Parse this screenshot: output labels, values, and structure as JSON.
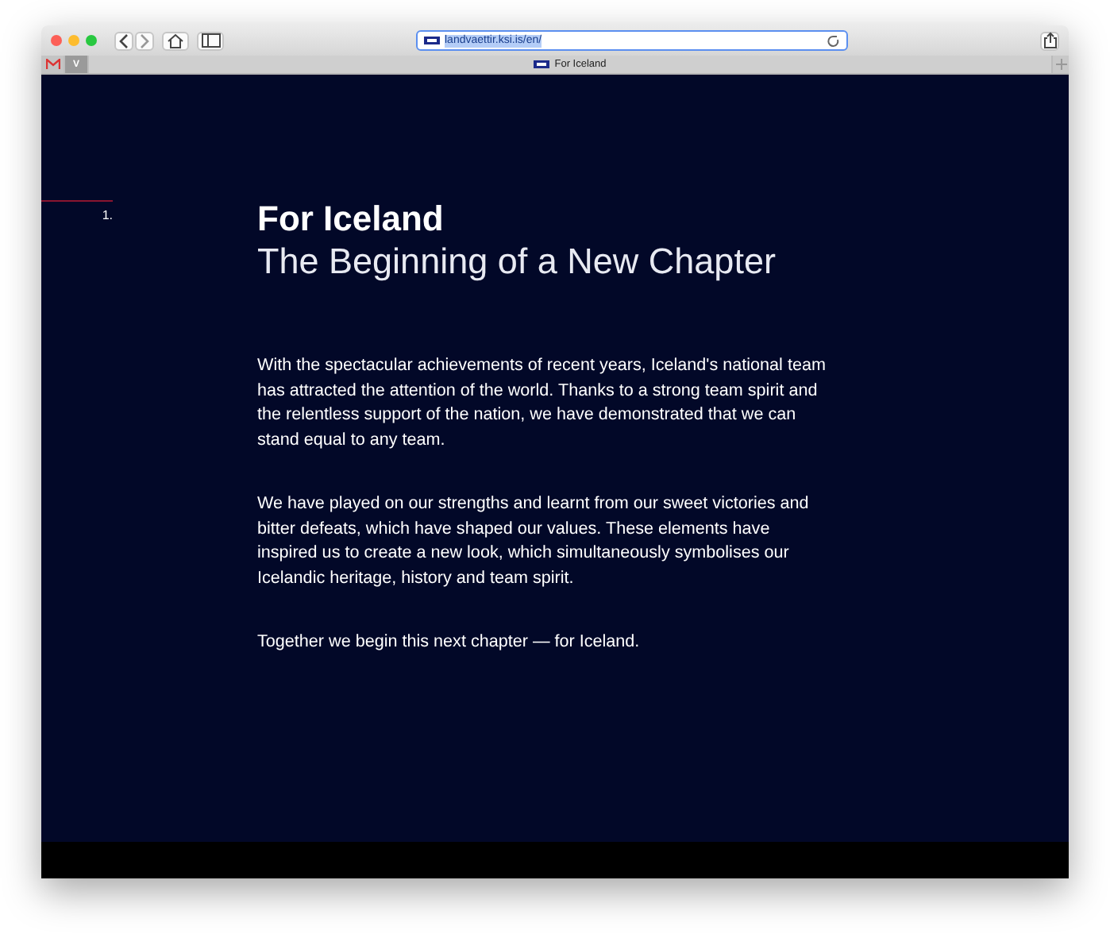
{
  "browser": {
    "url": "landvaettir.ksi.is/en/",
    "bookmarks": [
      {
        "kind": "mail"
      },
      {
        "kind": "letter",
        "label": "V"
      }
    ],
    "tab": {
      "title": "For Iceland"
    }
  },
  "page": {
    "section_number": "1.",
    "title": "For Iceland",
    "subtitle": "The Beginning of a New Chapter",
    "paragraphs": [
      "With the spectacular achievements of recent years, Iceland's national team has attracted the attention of the world. Thanks to a strong team spirit and the relentless support of the nation, we have demonstrated that we can stand equal to any team.",
      "We have played on our strengths and learnt from our sweet victories and bitter defeats, which have shaped our values. These elements have inspired us to create a new look, which simultaneously symbolises our Icelandic heritage, history and team spirit.",
      "Together we begin this next chapter — for Iceland."
    ]
  }
}
